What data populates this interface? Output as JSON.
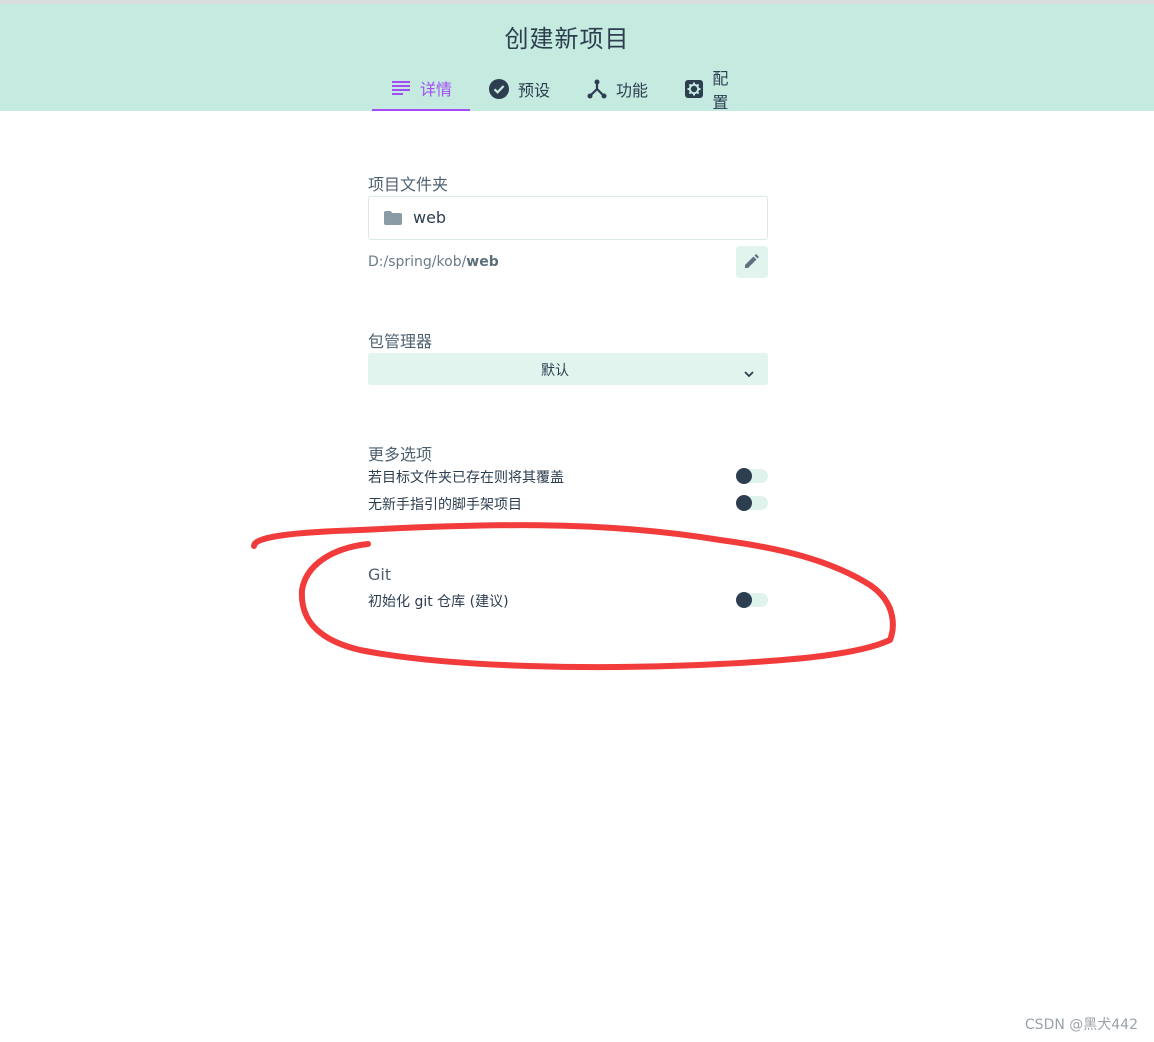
{
  "header": {
    "title": "创建新项目",
    "tabs": [
      {
        "label": "详情",
        "icon": "list-icon",
        "active": true
      },
      {
        "label": "预设",
        "icon": "check-circle-icon",
        "active": false
      },
      {
        "label": "功能",
        "icon": "merge-icon",
        "active": false
      },
      {
        "label": "配置",
        "icon": "gear-icon",
        "active": false
      }
    ]
  },
  "folder": {
    "label": "项目文件夹",
    "value": "web",
    "path_prefix": "D:/spring/kob/",
    "path_name": "web",
    "icon": "folder-icon",
    "edit_icon": "pencil-icon"
  },
  "package_manager": {
    "label": "包管理器",
    "selected": "默认",
    "icon": "chevron-down-icon"
  },
  "more_options": {
    "label": "更多选项",
    "items": [
      {
        "label": "若目标文件夹已存在则将其覆盖",
        "enabled": false
      },
      {
        "label": "无新手指引的脚手架项目",
        "enabled": false
      }
    ]
  },
  "git": {
    "label": "Git",
    "items": [
      {
        "label": "初始化 git 仓库 (建议)",
        "enabled": false
      }
    ]
  },
  "watermark": "CSDN @黑犬442",
  "colors": {
    "header_bg": "#c5eadf",
    "accent": "#a44cf6",
    "toggle_knob": "#2c3e50",
    "annotation_red": "#f23b3b"
  }
}
